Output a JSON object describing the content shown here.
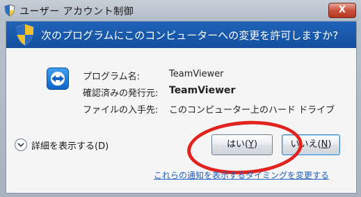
{
  "window": {
    "title": "ユーザー アカウント制御",
    "close_symbol": "X",
    "icons": {
      "title": "uac-shield-icon",
      "close": "close-icon"
    }
  },
  "banner": {
    "text": "次のプログラムにこのコンピューターへの変更を許可しますか?",
    "icon": "uac-shield-icon",
    "color": "#1f63b8"
  },
  "program": {
    "icon": "teamviewer-icon",
    "rows": [
      {
        "label": "プログラム名:",
        "value": "TeamViewer"
      },
      {
        "label": "確認済みの発行元:",
        "value": "TeamViewer"
      },
      {
        "label": "ファイルの入手先:",
        "value": "このコンピューター上のハード ドライブ"
      }
    ]
  },
  "details": {
    "label": "詳細を表示する(D)",
    "icon": "chevron-down-icon"
  },
  "buttons": {
    "yes": {
      "text": "はい(",
      "accel": "Y",
      "end": ")"
    },
    "no": {
      "text": "いいえ(",
      "accel": "N",
      "end": ")"
    }
  },
  "notification_link": "これらの通知を表示するタイミングを変更する",
  "annotation": {
    "color": "#e2221d"
  }
}
